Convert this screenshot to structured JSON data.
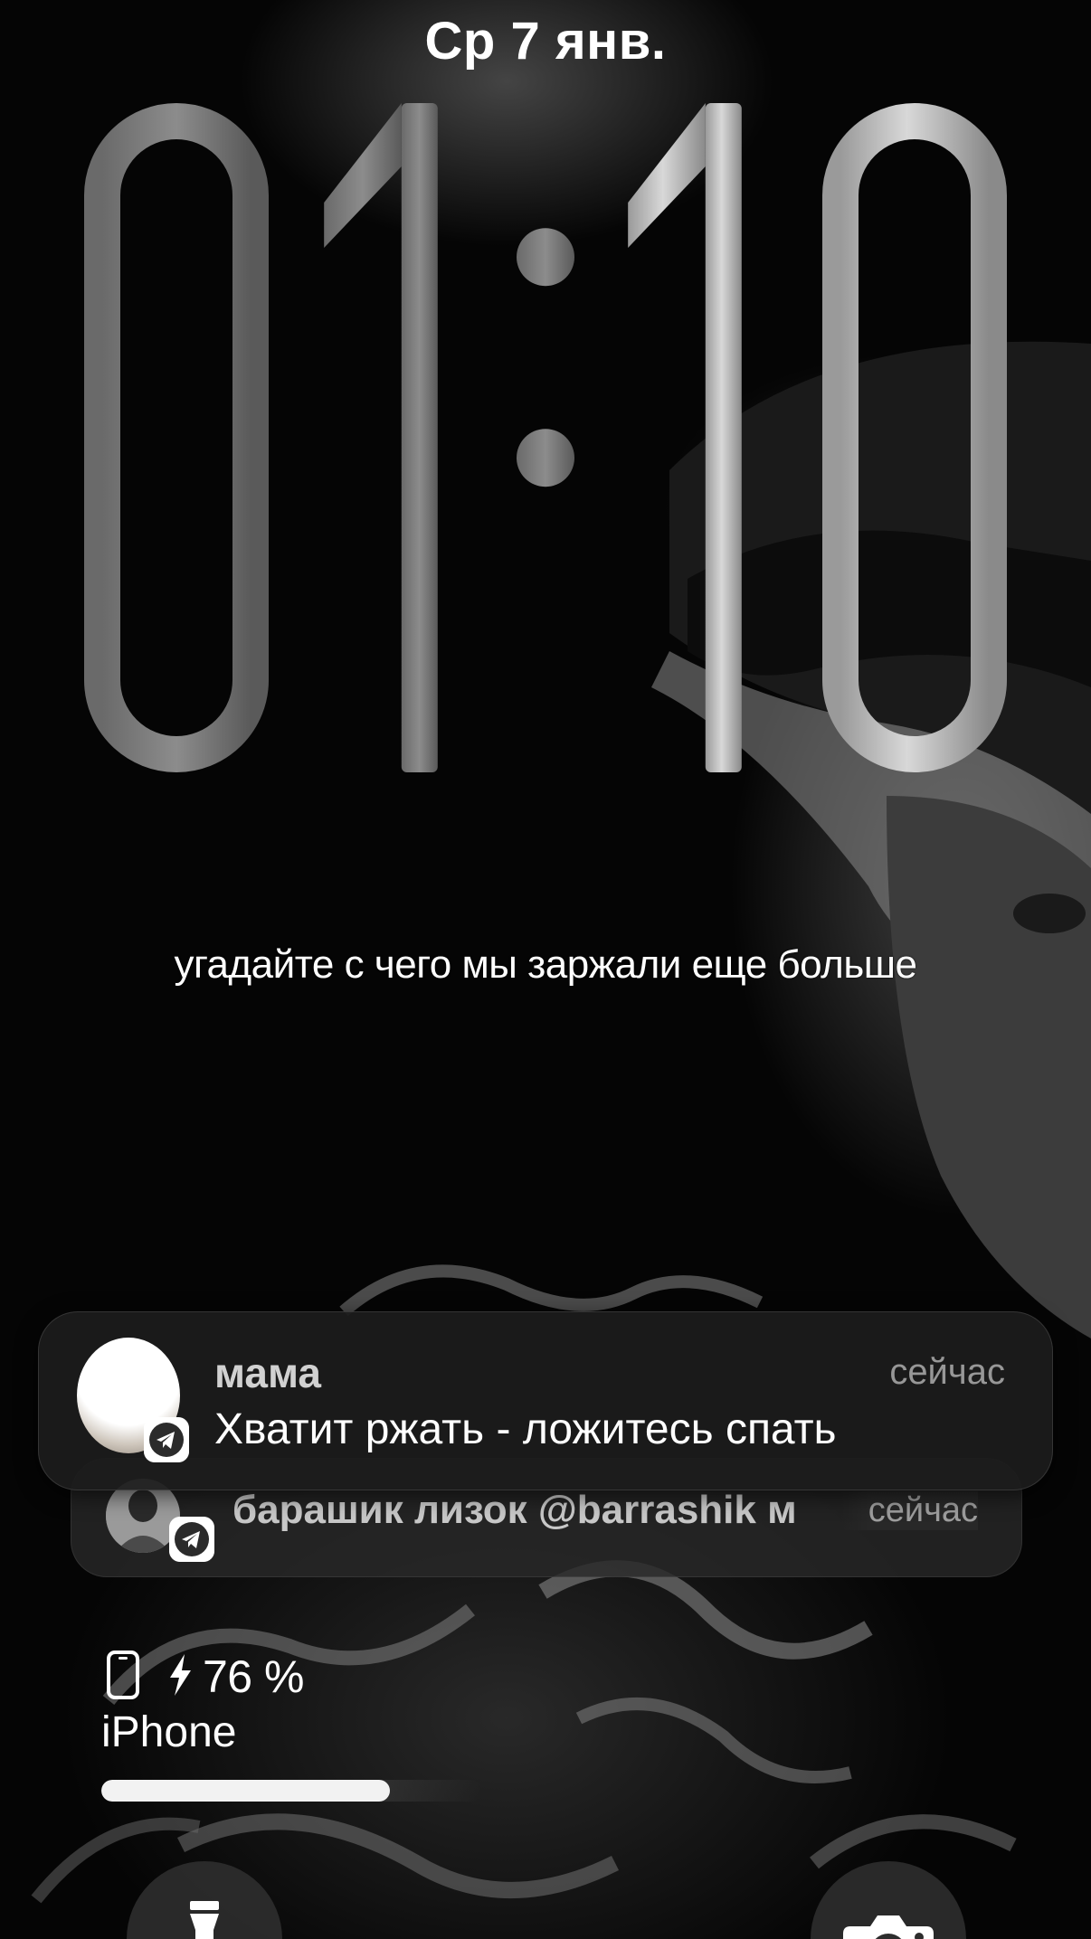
{
  "lock_screen": {
    "date": "Ср 7 янв.",
    "time": "01:10",
    "widget_text": "угадайте с чего мы заржали еще больше"
  },
  "notifications": [
    {
      "app_icon": "telegram-icon",
      "title": "мама",
      "time": "сейчас",
      "body": "Хватит ржать - ложитесь спать"
    },
    {
      "app_icon": "telegram-icon",
      "title": "барашик лизок @barrashik м",
      "time": "сейчас"
    }
  ],
  "battery": {
    "device_icon": "iphone-icon",
    "charging_icon": "bolt-icon",
    "percent_label": "76 %",
    "level": 0.76,
    "device_name": "iPhone"
  },
  "quick_actions": {
    "left": "flashlight-icon",
    "right": "camera-icon"
  },
  "colors": {
    "background": "#000000",
    "text": "#ffffff",
    "telegram": "#2b2b2b"
  }
}
